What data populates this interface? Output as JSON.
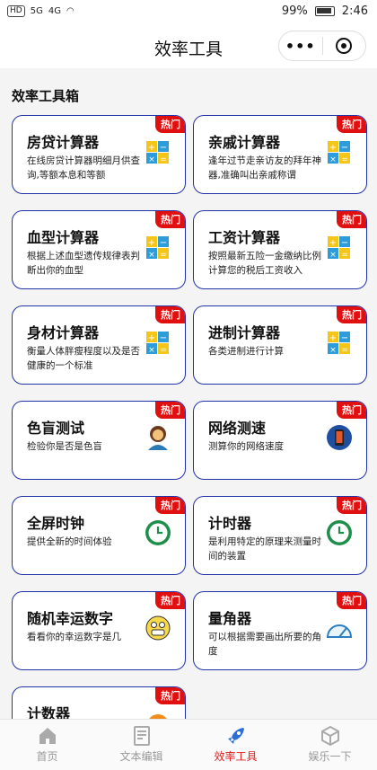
{
  "status": {
    "battery": "99%",
    "time": "2:46",
    "left_badges": [
      "HD",
      "5G",
      "4G"
    ]
  },
  "nav": {
    "title": "效率工具",
    "more": "•••"
  },
  "section": {
    "title": "效率工具箱"
  },
  "badge_text": "热门",
  "tools": [
    {
      "name": "房贷计算器",
      "desc": "在线房贷计算器明细月供查询,等额本息和等额",
      "icon": "calculator-icon"
    },
    {
      "name": "亲戚计算器",
      "desc": "逢年过节走亲访友的拜年神器,准确叫出亲戚称谓",
      "icon": "calculator-icon"
    },
    {
      "name": "血型计算器",
      "desc": "根据上述血型遗传规律表判断出你的血型",
      "icon": "calculator-icon"
    },
    {
      "name": "工资计算器",
      "desc": "按照最新五险一金缴纳比例计算您的税后工资收入",
      "icon": "calculator-icon"
    },
    {
      "name": "身材计算器",
      "desc": "衡量人体胖瘦程度以及是否健康的一个标准",
      "icon": "calculator-icon"
    },
    {
      "name": "进制计算器",
      "desc": "各类进制进行计算",
      "icon": "calculator-icon"
    },
    {
      "name": "色盲测试",
      "desc": "检验你是否是色盲",
      "icon": "person-icon"
    },
    {
      "name": "网络测速",
      "desc": "测算你的网络速度",
      "icon": "phone-icon"
    },
    {
      "name": "全屏时钟",
      "desc": "提供全新的时间体验",
      "icon": "clock-icon"
    },
    {
      "name": "计时器",
      "desc": "是利用特定的原理来测量时间的装置",
      "icon": "clock-icon"
    },
    {
      "name": "随机幸运数字",
      "desc": "看看你的幸运数字是几",
      "icon": "smiley-icon"
    },
    {
      "name": "量角器",
      "desc": "可以根据需要画出所要的角度",
      "icon": "protractor-icon"
    },
    {
      "name": "计数器",
      "desc": "",
      "icon": "counter-icon"
    }
  ],
  "tabs": [
    {
      "label": "首页",
      "icon": "home-icon",
      "active": false
    },
    {
      "label": "文本编辑",
      "icon": "document-icon",
      "active": false
    },
    {
      "label": "效率工具",
      "icon": "rocket-icon",
      "active": true
    },
    {
      "label": "娱乐一下",
      "icon": "cube-icon",
      "active": false
    }
  ],
  "colors": {
    "accent": "#e02020",
    "card_border": "#2233aa",
    "badge": "#e01010"
  }
}
